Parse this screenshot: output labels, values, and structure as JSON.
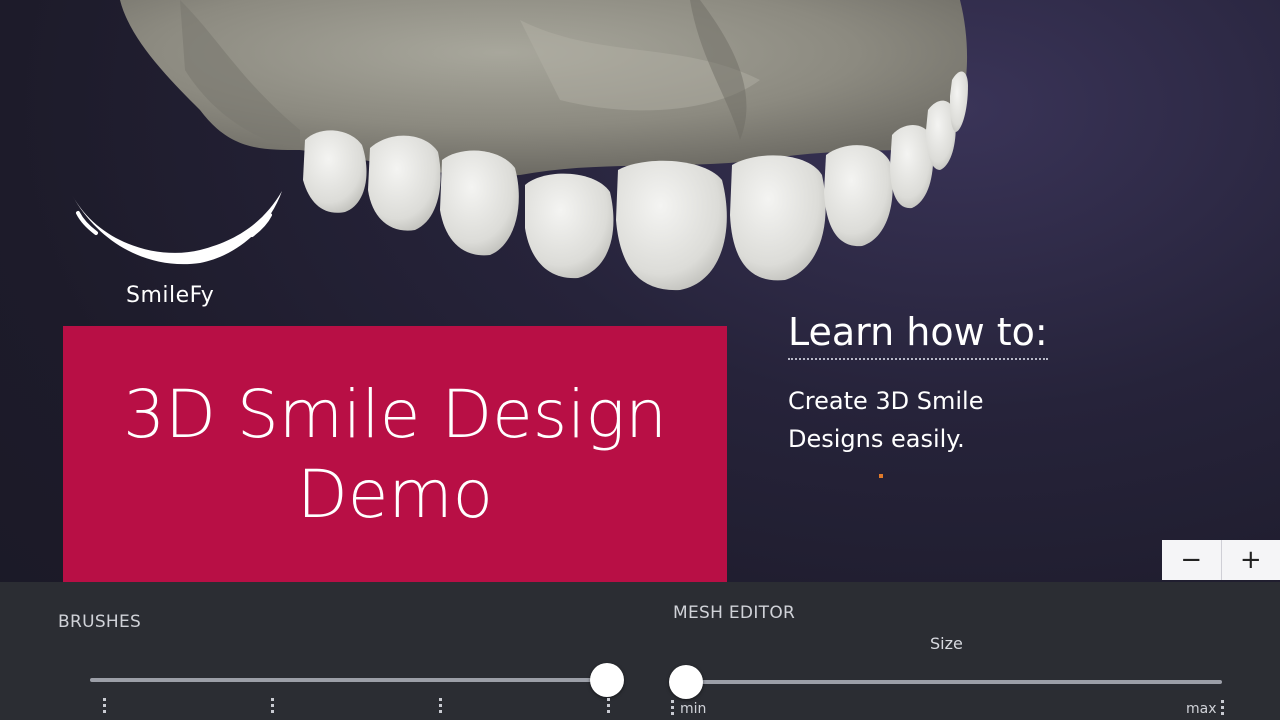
{
  "brand": {
    "logo_text": "SmileFy",
    "accent_color": "#b80f45"
  },
  "title_card": {
    "line1": "3D Smile Design",
    "line2": "Demo"
  },
  "learn": {
    "heading": "Learn how to:",
    "body": "Create 3D Smile Designs easily."
  },
  "zoom": {
    "minus_label": "−",
    "plus_label": "+"
  },
  "panel": {
    "brushes": {
      "label": "BRUSHES",
      "value_fraction": 1.0
    },
    "mesh_editor": {
      "label": "MESH EDITOR",
      "size_label": "Size",
      "min_label": "min",
      "max_label": "max",
      "value_fraction": 0.0
    }
  }
}
